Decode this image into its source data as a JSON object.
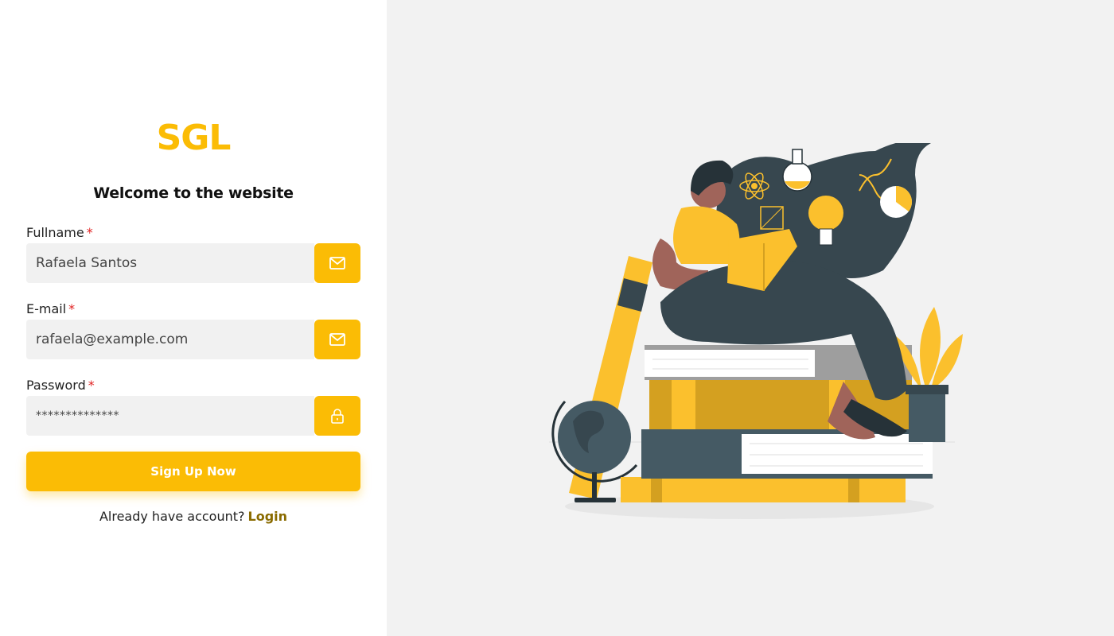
{
  "brand": {
    "logo": "SGL",
    "accent": "#fbbc05"
  },
  "form": {
    "heading": "Welcome to the website",
    "fullname": {
      "label": "Fullname",
      "required": "*",
      "value": "Rafaela Santos",
      "icon": "mail-icon"
    },
    "email": {
      "label": "E-mail",
      "required": "*",
      "value": "rafaela@example.com",
      "icon": "mail-icon"
    },
    "password": {
      "label": "Password",
      "required": "*",
      "value": "**************",
      "icon": "lock-icon"
    },
    "submit_label": "Sign Up Now",
    "login_prompt": "Already have account?",
    "login_link": "Login"
  },
  "illustration": {
    "icon": "girl-reading-on-books-illustration"
  }
}
